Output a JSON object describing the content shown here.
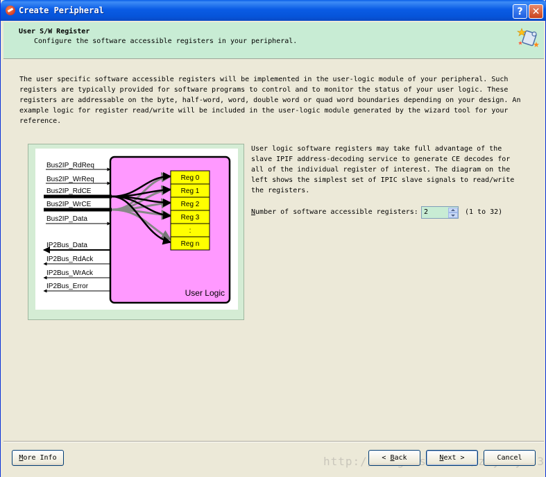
{
  "window": {
    "title": "Create Peripheral",
    "help_glyph": "?",
    "close_glyph": "✕"
  },
  "header": {
    "title": "User S/W Register",
    "subtitle": "Configure the software accessible registers in your peripheral."
  },
  "description": "The user specific software accessible registers will be implemented in the user-logic module of your peripheral. Such registers are typically provided for software programs to control and to monitor the status of your user logic. These registers are addressable on the byte, half-word, word, double word or quad word boundaries depending on your design. An example logic for register read/write will be included in the user-logic module generated by the wizard tool for your reference.",
  "side_text": "User logic software registers may take full advantage of the slave IPIF address-decoding service to generate CE decodes for all of the individual register of interest. The diagram on the left shows the simplest set of IPIC slave signals to read/write the registers.",
  "diagram": {
    "inputs": [
      "Bus2IP_RdReq",
      "Bus2IP_WrReq",
      "Bus2IP_RdCE",
      "Bus2IP_WrCE",
      "Bus2IP_Data"
    ],
    "outputs": [
      "IP2Bus_Data",
      "IP2Bus_RdAck",
      "IP2Bus_WrAck",
      "IP2Bus_Error"
    ],
    "registers": [
      "Reg 0",
      "Reg 1",
      "Reg 2",
      "Reg 3",
      ":",
      "Reg n"
    ],
    "block_label": "User Logic",
    "colors": {
      "block": "#ff99ff",
      "register": "#ffff00",
      "frame": "#d4ecd4"
    }
  },
  "registers_field": {
    "label_first": "N",
    "label_rest": "umber of software accessible registers:",
    "value": "2",
    "range": "(1 to 32)"
  },
  "buttons": {
    "more_info": {
      "first": "M",
      "rest": "ore Info"
    },
    "back": {
      "prefix": "< ",
      "first": "B",
      "rest": "ack"
    },
    "next": {
      "first": "N",
      "rest": "ext >"
    },
    "cancel": "Cancel"
  },
  "watermark": "http://blog.csdn.net/zhyfxy123"
}
